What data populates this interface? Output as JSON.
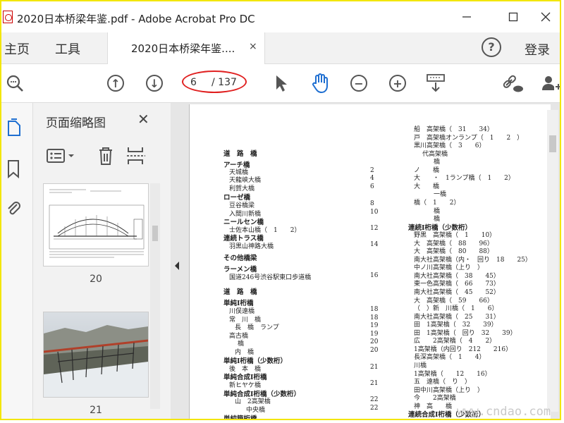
{
  "window": {
    "title": "2020日本桥梁年鉴.pdf - Adobe Acrobat Pro DC"
  },
  "menu": {
    "home": "主页",
    "tools": "工具",
    "login": "登录"
  },
  "tab": {
    "label": "2020日本桥梁年鉴....",
    "close": "×"
  },
  "toolbar": {
    "current_page": "6",
    "total_pages": "/ 137"
  },
  "thumbs": {
    "title": "页面缩略图",
    "pages": [
      "20",
      "21"
    ]
  },
  "doc": {
    "left_lines": [
      "道　路　橋",
      "アーチ橋",
      "天城橋",
      "天龍峡大橋",
      "利賀大橋",
      "ローゼ橋",
      "豆谷橋梁",
      "入間川新橋",
      "ニールセン橋",
      "士佐本山橋（　1　　2）",
      "連続トラス橋",
      "羽黒山神路大橋",
      "その他橋梁",
      "ラーメン橋",
      "国道246号渋谷駅東口歩道橋",
      "道　路　橋",
      "単純Ⅰ桁橋",
      "川俣遠橋",
      "常　川　橋",
      "長　橋　ランプ",
      "高古橋",
      "橋",
      "内　橋",
      "単純Ⅰ桁橋（少数桁）",
      "後　本　橋",
      "単純合成Ⅰ桁橋",
      "新ヒヤケ橋",
      "単純合成Ⅰ桁橋（少数桁）",
      "山　2高架橋",
      "中央橋",
      "単純箱桁橋"
    ],
    "left_nums": [
      "2",
      "4",
      "6",
      "8",
      "10",
      "12",
      "14",
      "16",
      "18",
      "18",
      "19",
      "19",
      "20",
      "20",
      "21",
      "21",
      "22",
      "22"
    ],
    "right_lines": [
      "船　高架橋（　31　　34）",
      "戸　高架橋オンランプ（　1　　2　）",
      "黒川高架橋（　3　　6）",
      "代高架橋",
      "橋",
      "ノ　　橋",
      "大　　・　1ランプ橋（　1　　2）",
      "大　　橋",
      "一橋",
      "橋（　1　　2）",
      "橋",
      "橋",
      "連続Ⅰ桁橋（少数桁）",
      "野黒　高架橋（　1　　10）",
      "大　高架橋（　88　　96）",
      "大　高架橋（　80　　88）",
      "南大社高架橋（内・　回り　18　　25）",
      "中ノ川高架橋（上り　）",
      "南大社高架橋（　38　　45）",
      "東一色高架橋（　66　　73）",
      "南大社高架橋（　45　　52）",
      "大　高架橋（　59　　66）",
      "（　）新　川橋（　1　　6）",
      "南大社高架橋（　25　　31）",
      "田　1高架橋（　32　　39）",
      "田　1高架橋（　回り　32　　39）",
      "広　　2高架橋（　4　　2）",
      "1高架橋（内回り　212　　216）",
      "長深高架橋（　1　　4）",
      "川橋",
      "1高架橋（　　12　　16）",
      "五　遠橋（　り　）",
      "田中川高架橋（上り　）",
      "今　　2高架橋",
      "神　高　　橋",
      "連続合成Ⅰ桁橋（少数桁）"
    ]
  },
  "watermark": "www.cndao.com"
}
